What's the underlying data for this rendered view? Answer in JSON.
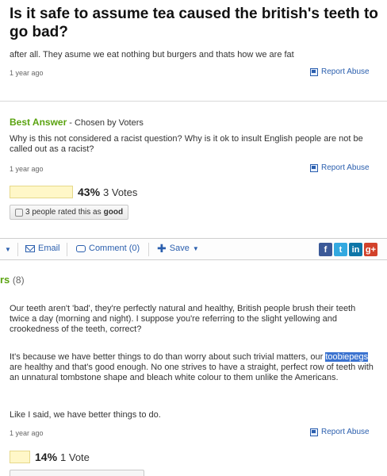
{
  "question": {
    "title": "Is it safe to assume tea caused the british's teeth to go bad?",
    "body": "after all. They asume we eat nothing but burgers and thats how we are fat",
    "time": "1 year ago",
    "report": "Report Abuse"
  },
  "best_answer": {
    "label": "Best Answer",
    "chosen": " - Chosen by Voters",
    "text": "Why is this not considered a racist question? Why is it ok to insult English people are not be called out as a racist?",
    "time": "1 year ago",
    "report": "Report Abuse",
    "rating_percent": "43%",
    "rating_votes": "3 Votes",
    "rated_prefix": "3 people rated this as",
    "rated_value": "good"
  },
  "actions": {
    "email": "Email",
    "comment": "Comment (0)",
    "save": "Save",
    "social": [
      "f",
      "t",
      "in",
      "g+"
    ]
  },
  "answers": {
    "heading": "rs",
    "count": "(8)",
    "answer1": {
      "p1": "Our teeth aren't 'bad', they're perfectly natural and healthy, British people brush their teeth twice a day (morning and night). I suppose you're referring to the slight yellowing and crookedness of the teeth, correct?",
      "p2_before": "It's because we have better things to do than worry about such trivial matters, our ",
      "p2_highlight": "toobiepegs",
      "p2_after": " are healthy and that's good enough. No one strives to have a straight, perfect row of teeth with an unnatural tombstone shape and bleach white colour to them unlike the Americans.",
      "p3": "Like I said, we have better things to do.",
      "time": "1 year ago",
      "report": "Report Abuse",
      "rating_percent": "14%",
      "rating_votes": "1 Vote"
    }
  }
}
